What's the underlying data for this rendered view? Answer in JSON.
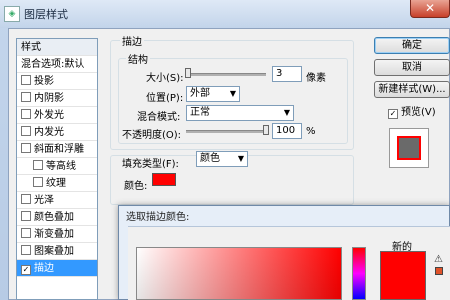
{
  "window": {
    "title": "图层样式",
    "close_label": "✕"
  },
  "style_list": {
    "header": "样式",
    "items": [
      {
        "label": "混合选项:默认",
        "checkbox": false,
        "checked": false,
        "indent": false,
        "selected": false
      },
      {
        "label": "投影",
        "checkbox": true,
        "checked": false,
        "indent": false,
        "selected": false
      },
      {
        "label": "内阴影",
        "checkbox": true,
        "checked": false,
        "indent": false,
        "selected": false
      },
      {
        "label": "外发光",
        "checkbox": true,
        "checked": false,
        "indent": false,
        "selected": false
      },
      {
        "label": "内发光",
        "checkbox": true,
        "checked": false,
        "indent": false,
        "selected": false
      },
      {
        "label": "斜面和浮雕",
        "checkbox": true,
        "checked": false,
        "indent": false,
        "selected": false
      },
      {
        "label": "等高线",
        "checkbox": true,
        "checked": false,
        "indent": true,
        "selected": false
      },
      {
        "label": "纹理",
        "checkbox": true,
        "checked": false,
        "indent": true,
        "selected": false
      },
      {
        "label": "光泽",
        "checkbox": true,
        "checked": false,
        "indent": false,
        "selected": false
      },
      {
        "label": "颜色叠加",
        "checkbox": true,
        "checked": false,
        "indent": false,
        "selected": false
      },
      {
        "label": "渐变叠加",
        "checkbox": true,
        "checked": false,
        "indent": false,
        "selected": false
      },
      {
        "label": "图案叠加",
        "checkbox": true,
        "checked": false,
        "indent": false,
        "selected": false
      },
      {
        "label": "描边",
        "checkbox": true,
        "checked": true,
        "indent": false,
        "selected": true
      }
    ]
  },
  "stroke": {
    "section_title": "描边",
    "structure_title": "结构",
    "size_label": "大小(S):",
    "size_value": "3",
    "size_unit": "像素",
    "size_slider_fraction": 0.03,
    "position_label": "位置(P):",
    "position_value": "外部",
    "blend_label": "混合模式:",
    "blend_value": "正常",
    "opacity_label": "不透明度(O):",
    "opacity_value": "100",
    "opacity_unit": "%",
    "opacity_slider_fraction": 1.0,
    "fill_type_label": "填充类型(F):",
    "fill_type_value": "颜色",
    "color_label": "颜色:",
    "color_value": "#ff0000"
  },
  "buttons": {
    "ok": "确定",
    "cancel": "取消",
    "new_style": "新建样式(W)...",
    "preview": "预览(V)",
    "preview_checked": true
  },
  "color_picker": {
    "title": "选取描边颜色:",
    "new_label": "新的",
    "new_color": "#ff0000"
  },
  "colors": {
    "selection": "#3399ff",
    "accent_red": "#ff0000"
  }
}
